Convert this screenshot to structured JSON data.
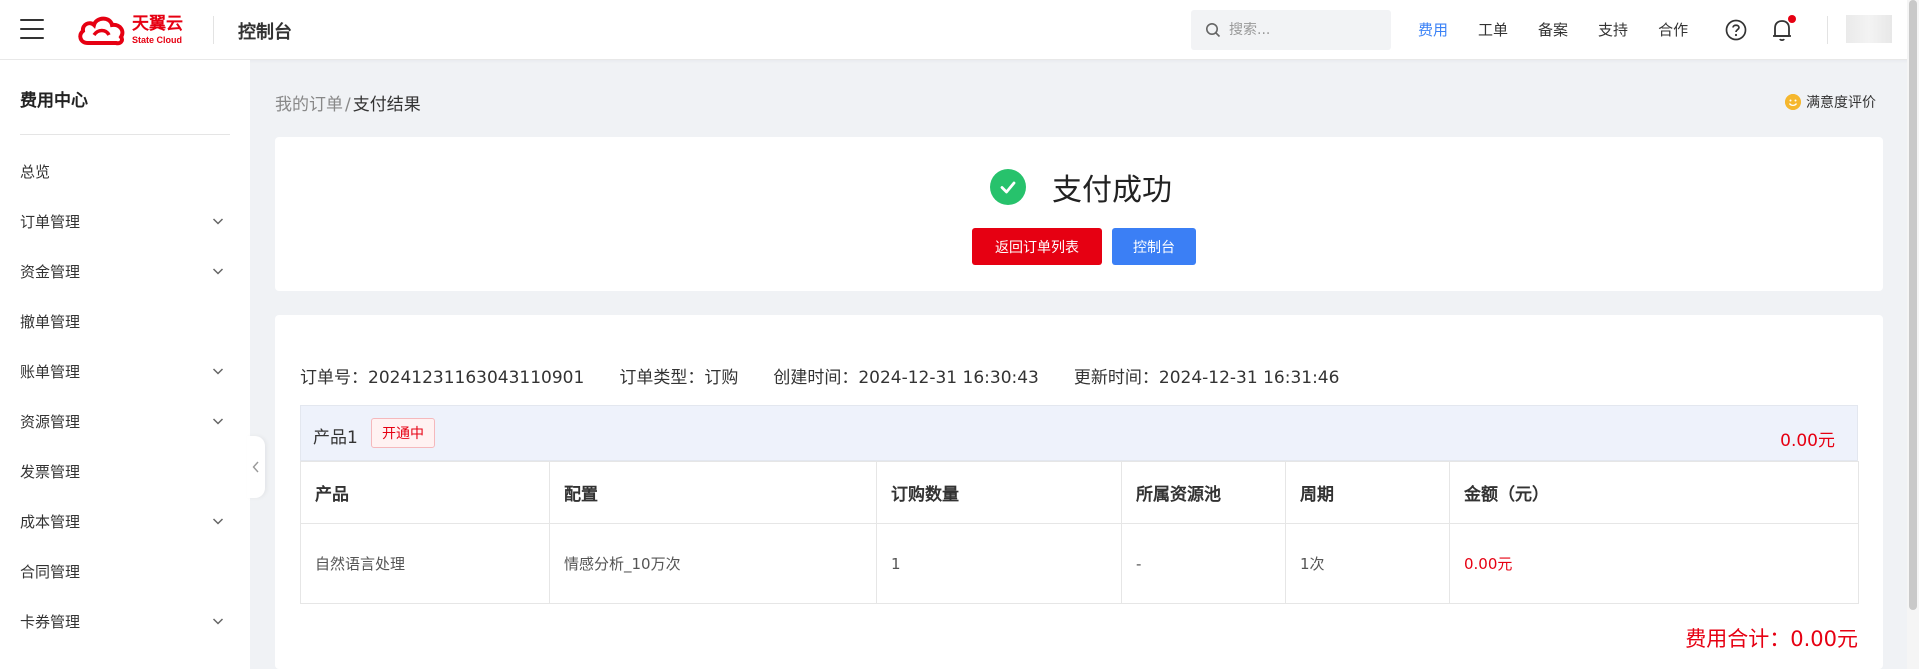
{
  "header": {
    "logo_cn": "天翼云",
    "logo_en": "State Cloud",
    "console_title": "控制台",
    "search_placeholder": "搜索...",
    "nav": [
      {
        "label": "费用",
        "active": true
      },
      {
        "label": "工单",
        "active": false
      },
      {
        "label": "备案",
        "active": false
      },
      {
        "label": "支持",
        "active": false
      },
      {
        "label": "合作",
        "active": false
      }
    ],
    "icons": [
      "menu-icon",
      "search-icon",
      "help-icon",
      "bell-icon"
    ],
    "accent_color": "#e60012",
    "link_color": "#3b82f6"
  },
  "sidebar": {
    "title": "费用中心",
    "items": [
      {
        "label": "总览",
        "expandable": false
      },
      {
        "label": "订单管理",
        "expandable": true
      },
      {
        "label": "资金管理",
        "expandable": true
      },
      {
        "label": "撤单管理",
        "expandable": false
      },
      {
        "label": "账单管理",
        "expandable": true
      },
      {
        "label": "资源管理",
        "expandable": true
      },
      {
        "label": "发票管理",
        "expandable": false
      },
      {
        "label": "成本管理",
        "expandable": true
      },
      {
        "label": "合同管理",
        "expandable": false
      },
      {
        "label": "卡券管理",
        "expandable": true
      }
    ]
  },
  "breadcrumb": {
    "parent": "我的订单",
    "separator": "/",
    "current": "支付结果"
  },
  "satisfaction_label": "满意度评价",
  "result": {
    "status_text": "支付成功",
    "success_color": "#27c26c",
    "back_button": "返回订单列表",
    "console_button": "控制台"
  },
  "order": {
    "order_no": "订单号：20241231163043110901",
    "order_type": "订单类型：订购",
    "created": "创建时间：2024-12-31 16:30:43",
    "updated": "更新时间：2024-12-31 16:31:46",
    "product_group": {
      "name": "产品1",
      "status": "开通中",
      "amount": "0.00元"
    },
    "table": {
      "columns": [
        "产品",
        "配置",
        "订购数量",
        "所属资源池",
        "周期",
        "金额（元）"
      ],
      "rows": [
        [
          "自然语言处理",
          "情感分析_10万次",
          "1",
          "-",
          "1次",
          "0.00元"
        ]
      ]
    },
    "total": "费用合计：0.00元"
  }
}
